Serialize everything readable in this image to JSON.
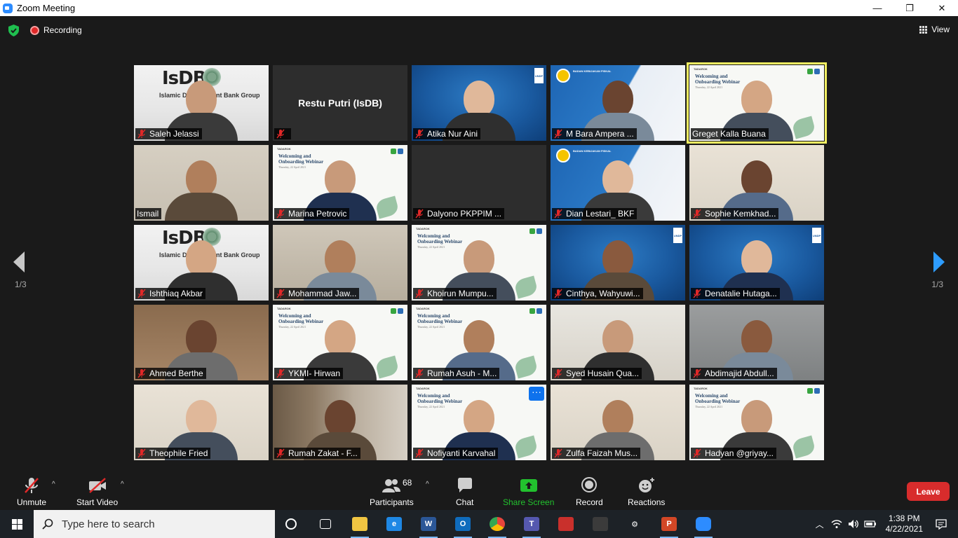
{
  "window": {
    "title": "Zoom Meeting",
    "controls": {
      "minimize": "—",
      "maximize": "❐",
      "close": "✕"
    }
  },
  "topbar": {
    "recording_label": "Recording",
    "view_label": "View"
  },
  "meeting": {
    "featured_name": "Restu Putri (IsDB)",
    "participants": [
      {
        "name": "Saleh Jelassi",
        "bg": "isdb",
        "muted": true,
        "banner": "Islamic Development Bank Group"
      },
      {
        "name": "",
        "bg": "dark",
        "muted": true,
        "camera_off_label": "Restu Putri (IsDB)"
      },
      {
        "name": "Atika Nur Aini",
        "bg": "blue",
        "muted": true
      },
      {
        "name": "M Bara Ampera ...",
        "bg": "building",
        "muted": true
      },
      {
        "name": "Greget Kalla Buana",
        "bg": "webinar",
        "muted": false,
        "active": true
      },
      {
        "name": "Ismail",
        "bg": "room",
        "muted": false
      },
      {
        "name": "Marina Petrovic",
        "bg": "webinar",
        "muted": true
      },
      {
        "name": "Dalyono PKPPIM ...",
        "bg": "dark",
        "muted": true
      },
      {
        "name": "Dian Lestari_ BKF",
        "bg": "building",
        "muted": true
      },
      {
        "name": "Sophie Kemkhad...",
        "bg": "wall",
        "muted": true
      },
      {
        "name": "Ishthiaq Akbar",
        "bg": "isdb",
        "muted": true,
        "banner": "Islamic Development Bank Group"
      },
      {
        "name": "Mohammad Jaw...",
        "bg": "office",
        "muted": true
      },
      {
        "name": "Khoirun Mumpu...",
        "bg": "webinar",
        "muted": true
      },
      {
        "name": "Cinthya, Wahyuwi...",
        "bg": "blue",
        "muted": true
      },
      {
        "name": "Denatalie Hutaga...",
        "bg": "blue",
        "muted": true
      },
      {
        "name": "Ahmed Berthe",
        "bg": "brown",
        "muted": true
      },
      {
        "name": "YKMI- Hirwan",
        "bg": "webinar",
        "muted": true
      },
      {
        "name": "Rumah Asuh - M...",
        "bg": "webinar",
        "muted": true
      },
      {
        "name": "Syed Husain Qua...",
        "bg": "lobby",
        "muted": true
      },
      {
        "name": "Abdimajid Abdull...",
        "bg": "grey",
        "muted": true
      },
      {
        "name": "Theophile Fried",
        "bg": "wall",
        "muted": true
      },
      {
        "name": "Rumah Zakat - F...",
        "bg": "shelf",
        "muted": true
      },
      {
        "name": "Nofiyanti Karvahal",
        "bg": "webinar",
        "muted": true,
        "more": true
      },
      {
        "name": "Zulfa Faizah Mus...",
        "bg": "wall",
        "muted": true
      },
      {
        "name": "Hadyan @griyay...",
        "bg": "webinar",
        "muted": true
      }
    ],
    "webinar_title_line1": "Welcoming and",
    "webinar_title_line2": "Onboarding Webinar",
    "webinar_date": "Thursday, 22 April 2021",
    "webinar_brand": "TADAROK",
    "undp": "UNDP",
    "isdb_logo": "IsDB",
    "bkf_text": "BADAN KEBIJAKAN FISKAL",
    "page_left": "1/3",
    "page_right": "1/3"
  },
  "toolbar": {
    "unmute": "Unmute",
    "start_video": "Start Video",
    "participants": "Participants",
    "participant_count": "68",
    "chat": "Chat",
    "share_screen": "Share Screen",
    "record": "Record",
    "reactions": "Reactions",
    "leave": "Leave",
    "more_dots": "···",
    "caret": "^"
  },
  "taskbar": {
    "search_placeholder": "Type here to search",
    "time": "1:38 PM",
    "date": "4/22/2021",
    "apps": [
      {
        "name": "cortana",
        "color": "#1d2227",
        "label": ""
      },
      {
        "name": "task-view",
        "color": "#1d2227",
        "label": ""
      },
      {
        "name": "file-explorer",
        "color": "#f0c542",
        "label": ""
      },
      {
        "name": "edge",
        "color": "#1e88e5",
        "label": "e"
      },
      {
        "name": "word",
        "color": "#2b5797",
        "label": "W"
      },
      {
        "name": "outlook",
        "color": "#0f6cbd",
        "label": "O"
      },
      {
        "name": "chrome",
        "color": "#e8453c",
        "label": ""
      },
      {
        "name": "teams",
        "color": "#5558af",
        "label": "T"
      },
      {
        "name": "antivirus",
        "color": "#c9302c",
        "label": ""
      },
      {
        "name": "calculator",
        "color": "#3b3b3b",
        "label": ""
      },
      {
        "name": "settings",
        "color": "#1d2227",
        "label": "⚙"
      },
      {
        "name": "powerpoint",
        "color": "#d24726",
        "label": "P"
      },
      {
        "name": "zoom",
        "color": "#2d8cff",
        "label": ""
      }
    ]
  },
  "colors": {
    "accent_blue": "#2d8cff",
    "active_speaker": "#f2ef62",
    "leave_red": "#d82c2c",
    "share_green": "#22c12e"
  }
}
